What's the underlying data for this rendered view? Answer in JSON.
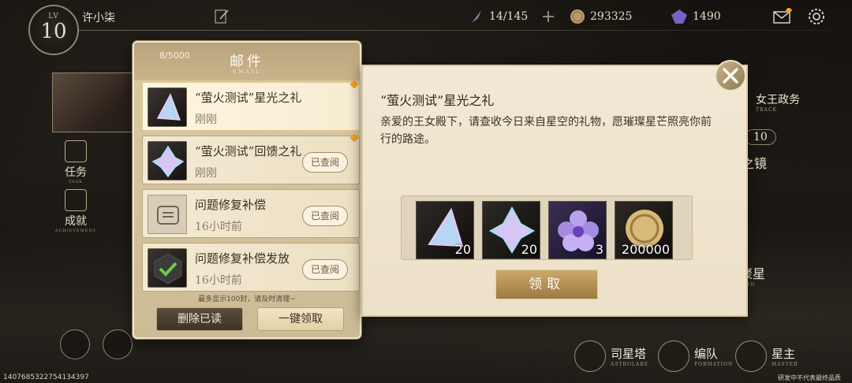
{
  "player": {
    "lv_label": "LV",
    "level": "10",
    "name": "许小柒"
  },
  "resources": {
    "stamina": "14/145",
    "coins": "293325",
    "gems": "1490"
  },
  "side_nav": {
    "task_label": "任务",
    "task_sub": "TASK",
    "achievement_label": "成就",
    "achievement_sub": "ACHIEVEMENT"
  },
  "mail": {
    "count": "8/5000",
    "title": "邮件",
    "title_sub": "EMAIL",
    "items": [
      {
        "name": "“萤火测试”星光之礼",
        "time": "刚刚",
        "read": ""
      },
      {
        "name": "“萤火测试”回馈之礼",
        "time": "刚刚",
        "read": "已查阅"
      },
      {
        "name": "问题修复补偿",
        "time": "16小时前",
        "read": "已查阅"
      },
      {
        "name": "问题修复补偿发放",
        "time": "16小时前",
        "read": "已查阅"
      }
    ],
    "hint": "最多显示100封，请及时清理~",
    "delete_label": "删除已读",
    "claim_all_label": "一键领取"
  },
  "detail": {
    "title": "“萤火测试”星光之礼",
    "body": "亲爱的王女殿下，请查收今日来自星空的礼物，愿璀璨星芒照亮你前行的路途。",
    "rewards": [
      {
        "icon": "prism-crystal-icon",
        "count": "20"
      },
      {
        "icon": "star-crystal-icon",
        "count": "20"
      },
      {
        "icon": "purple-flower-icon",
        "count": "3"
      },
      {
        "icon": "gold-coin-icon",
        "count": "200000"
      }
    ],
    "claim_label": "领取"
  },
  "right_panel": {
    "queen_affairs": "女王政务",
    "queen_affairs_sub": "TRACK",
    "badge_count": "10",
    "mirror_label": "之镜",
    "star_label": "聚星",
    "star_sub": "MON"
  },
  "bottom_nav": {
    "tower": "司星塔",
    "tower_sub": "ASTROLABE",
    "formation": "编队",
    "formation_sub": "FORMATION",
    "master": "星主",
    "master_sub": "MASTER"
  },
  "footer": {
    "uid": "14076853227541343​97",
    "disclaimer": "研发中不代表最终品质"
  },
  "colors": {
    "accent_gold": "#cba96b",
    "panel_cream": "#f2e8d4",
    "new_dot": "#f0a22c"
  }
}
